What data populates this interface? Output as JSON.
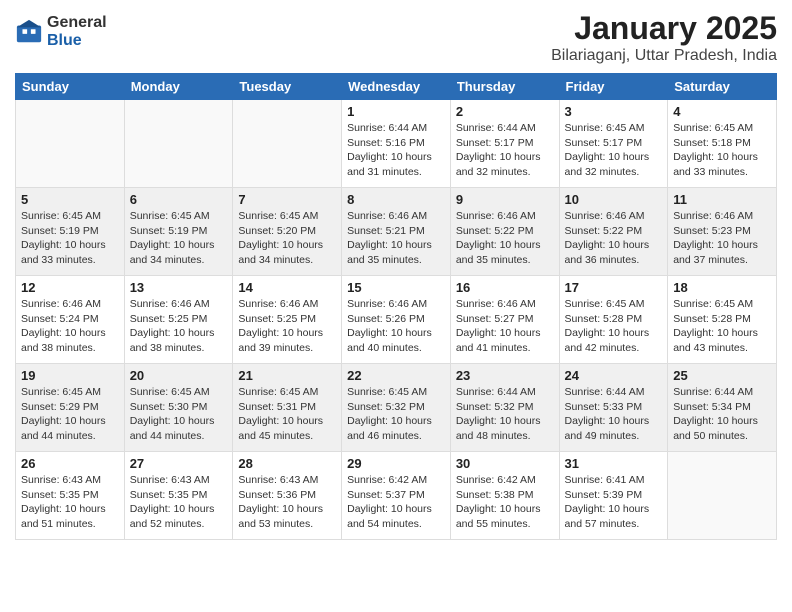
{
  "logo": {
    "general": "General",
    "blue": "Blue"
  },
  "title": "January 2025",
  "subtitle": "Bilariaganj, Uttar Pradesh, India",
  "weekdays": [
    "Sunday",
    "Monday",
    "Tuesday",
    "Wednesday",
    "Thursday",
    "Friday",
    "Saturday"
  ],
  "weeks": [
    [
      {
        "day": "",
        "info": ""
      },
      {
        "day": "",
        "info": ""
      },
      {
        "day": "",
        "info": ""
      },
      {
        "day": "1",
        "info": "Sunrise: 6:44 AM\nSunset: 5:16 PM\nDaylight: 10 hours\nand 31 minutes."
      },
      {
        "day": "2",
        "info": "Sunrise: 6:44 AM\nSunset: 5:17 PM\nDaylight: 10 hours\nand 32 minutes."
      },
      {
        "day": "3",
        "info": "Sunrise: 6:45 AM\nSunset: 5:17 PM\nDaylight: 10 hours\nand 32 minutes."
      },
      {
        "day": "4",
        "info": "Sunrise: 6:45 AM\nSunset: 5:18 PM\nDaylight: 10 hours\nand 33 minutes."
      }
    ],
    [
      {
        "day": "5",
        "info": "Sunrise: 6:45 AM\nSunset: 5:19 PM\nDaylight: 10 hours\nand 33 minutes."
      },
      {
        "day": "6",
        "info": "Sunrise: 6:45 AM\nSunset: 5:19 PM\nDaylight: 10 hours\nand 34 minutes."
      },
      {
        "day": "7",
        "info": "Sunrise: 6:45 AM\nSunset: 5:20 PM\nDaylight: 10 hours\nand 34 minutes."
      },
      {
        "day": "8",
        "info": "Sunrise: 6:46 AM\nSunset: 5:21 PM\nDaylight: 10 hours\nand 35 minutes."
      },
      {
        "day": "9",
        "info": "Sunrise: 6:46 AM\nSunset: 5:22 PM\nDaylight: 10 hours\nand 35 minutes."
      },
      {
        "day": "10",
        "info": "Sunrise: 6:46 AM\nSunset: 5:22 PM\nDaylight: 10 hours\nand 36 minutes."
      },
      {
        "day": "11",
        "info": "Sunrise: 6:46 AM\nSunset: 5:23 PM\nDaylight: 10 hours\nand 37 minutes."
      }
    ],
    [
      {
        "day": "12",
        "info": "Sunrise: 6:46 AM\nSunset: 5:24 PM\nDaylight: 10 hours\nand 38 minutes."
      },
      {
        "day": "13",
        "info": "Sunrise: 6:46 AM\nSunset: 5:25 PM\nDaylight: 10 hours\nand 38 minutes."
      },
      {
        "day": "14",
        "info": "Sunrise: 6:46 AM\nSunset: 5:25 PM\nDaylight: 10 hours\nand 39 minutes."
      },
      {
        "day": "15",
        "info": "Sunrise: 6:46 AM\nSunset: 5:26 PM\nDaylight: 10 hours\nand 40 minutes."
      },
      {
        "day": "16",
        "info": "Sunrise: 6:46 AM\nSunset: 5:27 PM\nDaylight: 10 hours\nand 41 minutes."
      },
      {
        "day": "17",
        "info": "Sunrise: 6:45 AM\nSunset: 5:28 PM\nDaylight: 10 hours\nand 42 minutes."
      },
      {
        "day": "18",
        "info": "Sunrise: 6:45 AM\nSunset: 5:28 PM\nDaylight: 10 hours\nand 43 minutes."
      }
    ],
    [
      {
        "day": "19",
        "info": "Sunrise: 6:45 AM\nSunset: 5:29 PM\nDaylight: 10 hours\nand 44 minutes."
      },
      {
        "day": "20",
        "info": "Sunrise: 6:45 AM\nSunset: 5:30 PM\nDaylight: 10 hours\nand 44 minutes."
      },
      {
        "day": "21",
        "info": "Sunrise: 6:45 AM\nSunset: 5:31 PM\nDaylight: 10 hours\nand 45 minutes."
      },
      {
        "day": "22",
        "info": "Sunrise: 6:45 AM\nSunset: 5:32 PM\nDaylight: 10 hours\nand 46 minutes."
      },
      {
        "day": "23",
        "info": "Sunrise: 6:44 AM\nSunset: 5:32 PM\nDaylight: 10 hours\nand 48 minutes."
      },
      {
        "day": "24",
        "info": "Sunrise: 6:44 AM\nSunset: 5:33 PM\nDaylight: 10 hours\nand 49 minutes."
      },
      {
        "day": "25",
        "info": "Sunrise: 6:44 AM\nSunset: 5:34 PM\nDaylight: 10 hours\nand 50 minutes."
      }
    ],
    [
      {
        "day": "26",
        "info": "Sunrise: 6:43 AM\nSunset: 5:35 PM\nDaylight: 10 hours\nand 51 minutes."
      },
      {
        "day": "27",
        "info": "Sunrise: 6:43 AM\nSunset: 5:35 PM\nDaylight: 10 hours\nand 52 minutes."
      },
      {
        "day": "28",
        "info": "Sunrise: 6:43 AM\nSunset: 5:36 PM\nDaylight: 10 hours\nand 53 minutes."
      },
      {
        "day": "29",
        "info": "Sunrise: 6:42 AM\nSunset: 5:37 PM\nDaylight: 10 hours\nand 54 minutes."
      },
      {
        "day": "30",
        "info": "Sunrise: 6:42 AM\nSunset: 5:38 PM\nDaylight: 10 hours\nand 55 minutes."
      },
      {
        "day": "31",
        "info": "Sunrise: 6:41 AM\nSunset: 5:39 PM\nDaylight: 10 hours\nand 57 minutes."
      },
      {
        "day": "",
        "info": ""
      }
    ]
  ]
}
